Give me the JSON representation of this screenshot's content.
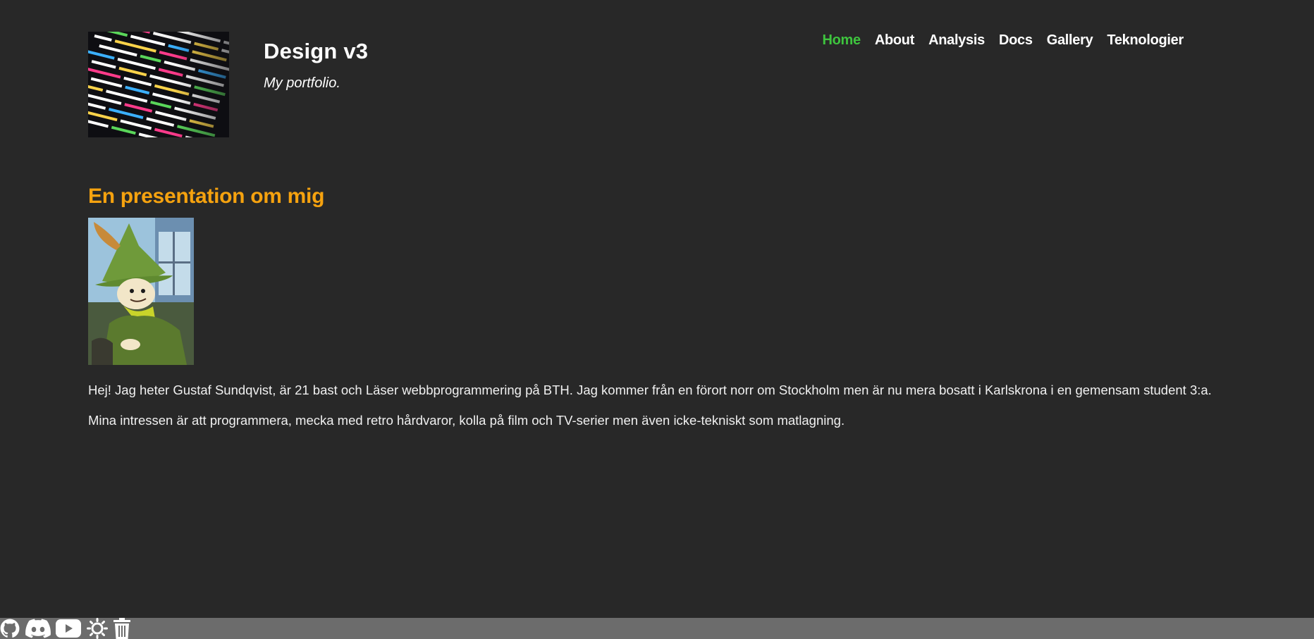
{
  "header": {
    "logo_name": "code-screen-logo",
    "title": "Design v3",
    "slogan": "My portfolio."
  },
  "nav": {
    "items": [
      {
        "label": "Home",
        "active": true
      },
      {
        "label": "About",
        "active": false
      },
      {
        "label": "Analysis",
        "active": false
      },
      {
        "label": "Docs",
        "active": false
      },
      {
        "label": "Gallery",
        "active": false
      },
      {
        "label": "Teknologier",
        "active": false
      }
    ]
  },
  "main": {
    "heading": "En presentation om mig",
    "portrait_name": "snufkin-portrait",
    "paragraphs": [
      "Hej! Jag heter Gustaf Sundqvist, är 21 bast och Läser webbprogrammering på BTH. Jag kommer från en förort norr om Stockholm men är nu mera bosatt i Karlskrona i en gemensam student 3:a.",
      "Mina intressen är att programmera, mecka med retro hårdvaror, kolla på film och TV-serier men även icke-tekniskt som matlagning."
    ]
  },
  "footer": {
    "icons": [
      "github-icon",
      "discord-icon",
      "youtube-icon",
      "theme-toggle-icon",
      "trash-icon"
    ]
  },
  "colors": {
    "background": "#282828",
    "accent_heading": "#f5a20f",
    "nav_active": "#3ec43e",
    "footer_bar": "#6c6c6c"
  }
}
